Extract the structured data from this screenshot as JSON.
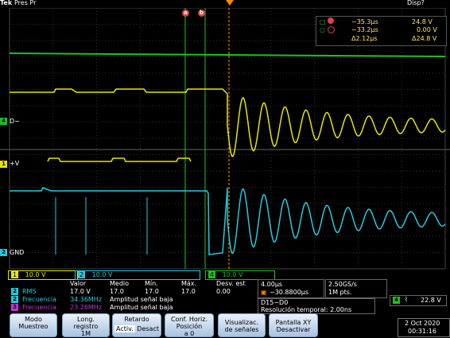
{
  "header": {
    "brand": "Tek",
    "mode": "Pres Pr",
    "display": "Disp?",
    "cursor_a": "a",
    "cursor_b": "b"
  },
  "colors": {
    "ch1": "#e6e600",
    "ch2": "#25c9e0",
    "ch3": "#d030d0",
    "ch4": "#20c020",
    "cursor": "#e04040"
  },
  "cursor_readout": {
    "row1_time": "−35.3µs",
    "row1_val": "24.8 V",
    "row2_time": "−33.2µs",
    "row2_val": "0.00 V",
    "row3_time": "Δ2.12µs",
    "row3_val": "Δ24.8 V"
  },
  "labels": {
    "d_minus": "D−",
    "plus_v": "+V",
    "gnd": "GND",
    "ch1_num": "1",
    "ch2_num": "2",
    "ch4_num": "4"
  },
  "channels": [
    {
      "num": "1",
      "scale": "10.0 V"
    },
    {
      "num": "2",
      "scale": "10.0 V"
    },
    {
      "num": "4",
      "scale": "10.0 V"
    }
  ],
  "measurements": {
    "headers": [
      "Valor",
      "Medio",
      "Mín.",
      "Máx.",
      "Desv. est"
    ],
    "rows": [
      {
        "ch": "2",
        "name": "RMS",
        "values": [
          "17.0 V",
          "17.0",
          "17.0",
          "17.0",
          "0.00"
        ]
      },
      {
        "ch": "2",
        "name": "Frecuencia",
        "values": [
          "34.36MHz",
          "Amplitud señal baja"
        ]
      },
      {
        "ch": "3",
        "name": "Frecuencia",
        "values": [
          "23.26MHz",
          "Amplitud señal baja"
        ]
      }
    ]
  },
  "timebase": {
    "scale": "4.00µs",
    "delay": "−30.8800µs",
    "rate": "2.50GS/s",
    "points": "1M pts."
  },
  "bus": {
    "name": "D15−D0",
    "resolution": "Resolución temporal: 2.00ns"
  },
  "trigger": {
    "ch": "4",
    "level": "22.8 V"
  },
  "buttons": {
    "modo": [
      "Modo",
      "Muestreo"
    ],
    "long": [
      "Long.",
      "registro",
      "1M"
    ],
    "retardo": [
      "Retardo",
      "Activ.",
      "Desact"
    ],
    "conf": [
      "Conf. Horiz.",
      "Posición",
      "a 0"
    ],
    "visual": [
      "Visualizac.",
      "de señales"
    ],
    "pantalla": [
      "Pantalla XY",
      "Desactivar"
    ]
  },
  "datetime": {
    "date": "2 Oct  2020",
    "time": "00:31:16"
  }
}
